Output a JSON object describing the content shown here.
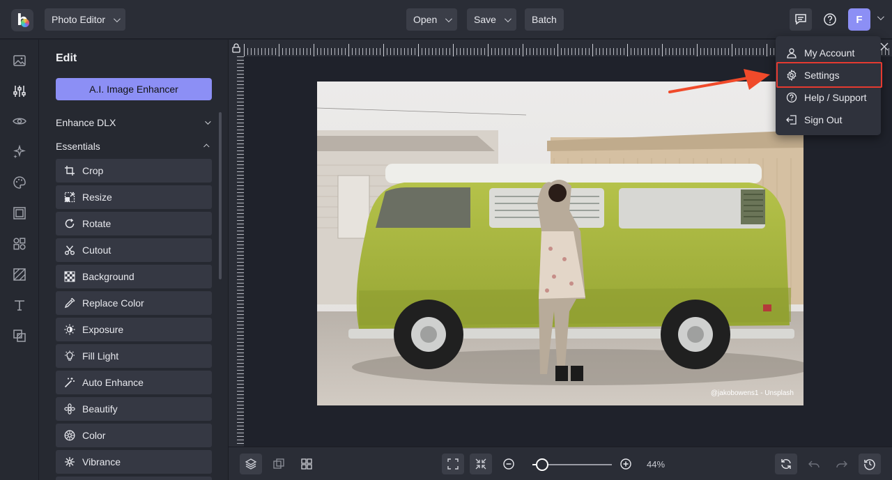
{
  "header": {
    "app_mode": "Photo Editor",
    "open_label": "Open",
    "save_label": "Save",
    "batch_label": "Batch",
    "avatar_letter": "F"
  },
  "sidebar": {
    "title": "Edit",
    "ai_button": "A.I. Image Enhancer",
    "sections": [
      {
        "label": "Enhance DLX",
        "expanded": false
      },
      {
        "label": "Essentials",
        "expanded": true
      }
    ],
    "tools": [
      {
        "label": "Crop",
        "icon": "crop-icon"
      },
      {
        "label": "Resize",
        "icon": "resize-icon"
      },
      {
        "label": "Rotate",
        "icon": "rotate-icon"
      },
      {
        "label": "Cutout",
        "icon": "cutout-icon"
      },
      {
        "label": "Background",
        "icon": "background-icon"
      },
      {
        "label": "Replace Color",
        "icon": "replace-color-icon"
      },
      {
        "label": "Exposure",
        "icon": "exposure-icon"
      },
      {
        "label": "Fill Light",
        "icon": "fill-light-icon"
      },
      {
        "label": "Auto Enhance",
        "icon": "auto-enhance-icon"
      },
      {
        "label": "Beautify",
        "icon": "beautify-icon"
      },
      {
        "label": "Color",
        "icon": "color-icon"
      },
      {
        "label": "Vibrance",
        "icon": "vibrance-icon"
      }
    ]
  },
  "canvas": {
    "photo_credit": "@jakobowens1 - Unsplash"
  },
  "bottom": {
    "zoom_label": "44%",
    "zoom_fraction": 0.12
  },
  "account_menu": {
    "items": [
      {
        "label": "My Account",
        "icon": "user-icon"
      },
      {
        "label": "Settings",
        "icon": "gear-icon",
        "highlighted": true
      },
      {
        "label": "Help / Support",
        "icon": "help-icon"
      },
      {
        "label": "Sign Out",
        "icon": "sign-out-icon"
      }
    ]
  },
  "colors": {
    "accent": "#8c8ff5",
    "annotation_red": "#e63a30"
  }
}
